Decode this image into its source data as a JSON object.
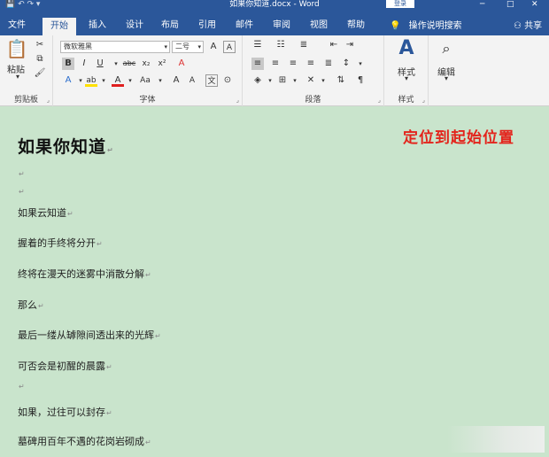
{
  "window": {
    "title": "如果你知道.docx - Word",
    "login_label": "登录",
    "min_glyph": "─",
    "restore_glyph": "□",
    "close_glyph": "✕"
  },
  "tabs": [
    {
      "label": "文件"
    },
    {
      "label": "开始"
    },
    {
      "label": "插入"
    },
    {
      "label": "设计"
    },
    {
      "label": "布局"
    },
    {
      "label": "引用"
    },
    {
      "label": "邮件"
    },
    {
      "label": "审阅"
    },
    {
      "label": "视图"
    },
    {
      "label": "帮助"
    }
  ],
  "tellme": {
    "icon": "lightbulb-icon",
    "label": "操作说明搜索"
  },
  "share": {
    "label": "共享"
  },
  "ribbon": {
    "clipboard": {
      "label": "剪贴板",
      "paste_label": "粘贴"
    },
    "font": {
      "label": "字体",
      "font_name": "微软雅黑",
      "font_size": "二号",
      "bold": "B",
      "italic": "I",
      "underline": "U",
      "strike": "abc",
      "subscript": "x₂",
      "superscript": "x²",
      "text_effect": "A",
      "highlight": "ab",
      "font_color": "A",
      "change_case": "Aa",
      "grow": "A",
      "shrink": "A",
      "phonetic": "文",
      "clear_format": "A"
    },
    "paragraph": {
      "label": "段落"
    },
    "styles": {
      "label": "样式",
      "btn_label": "样式"
    },
    "editing": {
      "label": "编辑"
    }
  },
  "document": {
    "heading": "如果你知道",
    "annotation": "定位到起始位置",
    "paragraph_mark": "↵",
    "lines": [
      "",
      "",
      "如果云知道",
      "握着的手终将分开",
      "终将在漫天的迷雾中消散分解",
      "那么",
      "最后一缕从罅隙间透出来的光辉",
      "可否会是初醒的晨露",
      "",
      "如果，过往可以封存",
      "墓碑用百年不遇的花岗岩砌成"
    ]
  }
}
